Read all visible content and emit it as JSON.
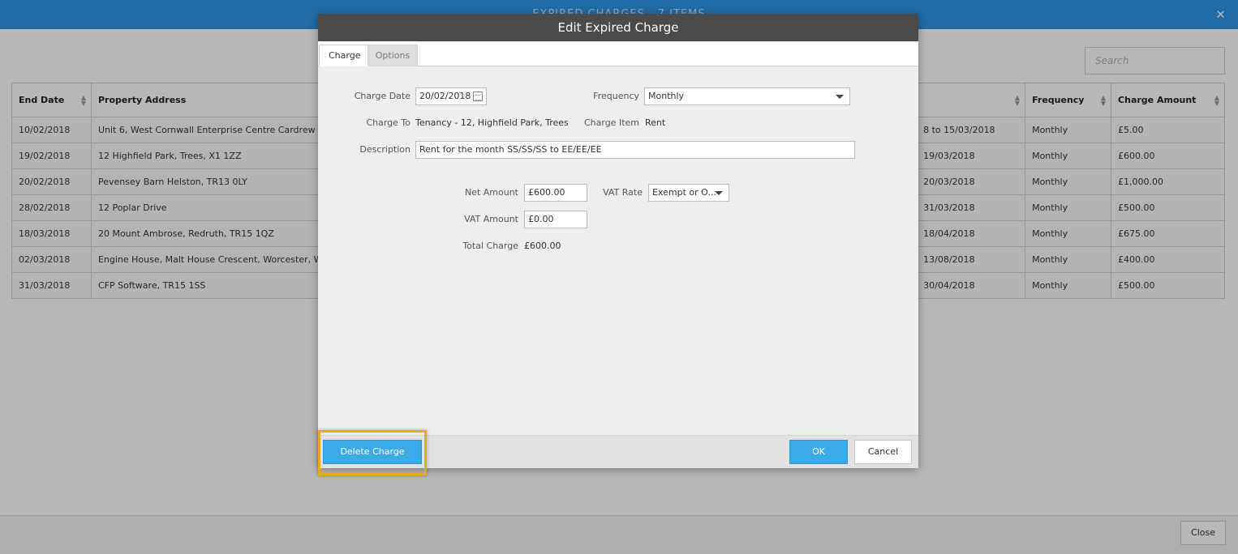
{
  "background": {
    "title": "EXPIRED CHARGES - 7 ITEMS",
    "search_placeholder": "Search",
    "columns": [
      "End Date",
      "Property Address",
      "",
      "Frequency",
      "Charge Amount"
    ],
    "rows": [
      {
        "end_date": "10/02/2018",
        "address": "Unit 6, West Cornwall Enterprise Centre Cardrew Way, Re",
        "period": "8 to 15/03/2018",
        "frequency": "Monthly",
        "amount": "£5.00"
      },
      {
        "end_date": "19/02/2018",
        "address": "12 Highfield Park, Trees, X1 1ZZ",
        "period": "19/03/2018",
        "frequency": "Monthly",
        "amount": "£600.00"
      },
      {
        "end_date": "20/02/2018",
        "address": "Pevensey Barn Helston, TR13 0LY",
        "period": "20/03/2018",
        "frequency": "Monthly",
        "amount": "£1,000.00"
      },
      {
        "end_date": "28/02/2018",
        "address": "12 Poplar Drive",
        "period": "31/03/2018",
        "frequency": "Monthly",
        "amount": "£500.00"
      },
      {
        "end_date": "18/03/2018",
        "address": "20 Mount Ambrose, Redruth, TR15 1QZ",
        "period": "18/04/2018",
        "frequency": "Monthly",
        "amount": "£675.00"
      },
      {
        "end_date": "02/03/2018",
        "address": "Engine House, Malt House Crescent, Worcester, WR7 4E",
        "period": "13/08/2018",
        "frequency": "Monthly",
        "amount": "£400.00"
      },
      {
        "end_date": "31/03/2018",
        "address": "CFP Software, TR15 1SS",
        "period": "30/04/2018",
        "frequency": "Monthly",
        "amount": "£500.00"
      }
    ],
    "close_label": "Close"
  },
  "dialog": {
    "title": "Edit Expired Charge",
    "tabs": [
      {
        "label": "Charge"
      },
      {
        "label": "Options"
      }
    ],
    "charge_date_label": "Charge Date",
    "charge_date_value": "20/02/2018",
    "frequency_label": "Frequency",
    "frequency_value": "Monthly",
    "charge_to_label": "Charge To",
    "charge_to_value": "Tenancy - 12, Highfield Park, Trees",
    "charge_item_label": "Charge Item",
    "charge_item_value": "Rent",
    "description_label": "Description",
    "description_value": "Rent for the month SS/SS/SS to EE/EE/EE",
    "net_amount_label": "Net Amount",
    "net_amount_value": "£600.00",
    "vat_rate_label": "VAT Rate",
    "vat_rate_value": "Exempt or O...",
    "vat_amount_label": "VAT Amount",
    "vat_amount_value": "£0.00",
    "total_charge_label": "Total Charge",
    "total_charge_value": "£600.00",
    "delete_label": "Delete Charge",
    "ok_label": "OK",
    "cancel_label": "Cancel"
  },
  "colors": {
    "accent": "#3aabe6",
    "titlebar": "#2e95e6",
    "highlight": "#f0a81a",
    "dialog_header": "#4a4a4a"
  }
}
